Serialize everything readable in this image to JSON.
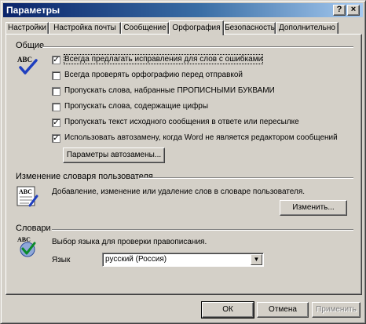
{
  "window": {
    "title": "Параметры",
    "help_glyph": "?",
    "close_glyph": "×"
  },
  "tabs": [
    {
      "label": "Настройки"
    },
    {
      "label": "Настройка почты"
    },
    {
      "label": "Сообщение"
    },
    {
      "label": "Орфография",
      "active": true
    },
    {
      "label": "Безопасность"
    },
    {
      "label": "Дополнительно"
    }
  ],
  "general": {
    "title": "Общие",
    "options": [
      {
        "label": "Всегда предлагать исправления для слов с ошибками",
        "checked": true
      },
      {
        "label": "Всегда проверять орфографию перед отправкой",
        "checked": false
      },
      {
        "label": "Пропускать слова, набранные ПРОПИСНЫМИ БУКВАМИ",
        "checked": false
      },
      {
        "label": "Пропускать слова, содержащие цифры",
        "checked": false
      },
      {
        "label": "Пропускать текст исходного сообщения в ответе или пересылке",
        "checked": true
      },
      {
        "label": "Использовать автозамену, когда Word не является редактором сообщений",
        "checked": true
      }
    ],
    "autocorrect_button": "Параметры автозамены...",
    "check_glyph": "✓"
  },
  "user_dictionary": {
    "title": "Изменение словаря пользователя",
    "description": "Добавление, изменение или удаление слов в словаре пользователя.",
    "edit_button": "Изменить..."
  },
  "dictionaries": {
    "title": "Словари",
    "description": "Выбор языка для проверки правописания.",
    "language_label": "Язык",
    "language_value": "русский (Россия)",
    "dropdown_glyph": "▼"
  },
  "footer": {
    "ok": "ОК",
    "cancel": "Отмена",
    "apply": "Применить"
  },
  "icon_text": "ABC"
}
